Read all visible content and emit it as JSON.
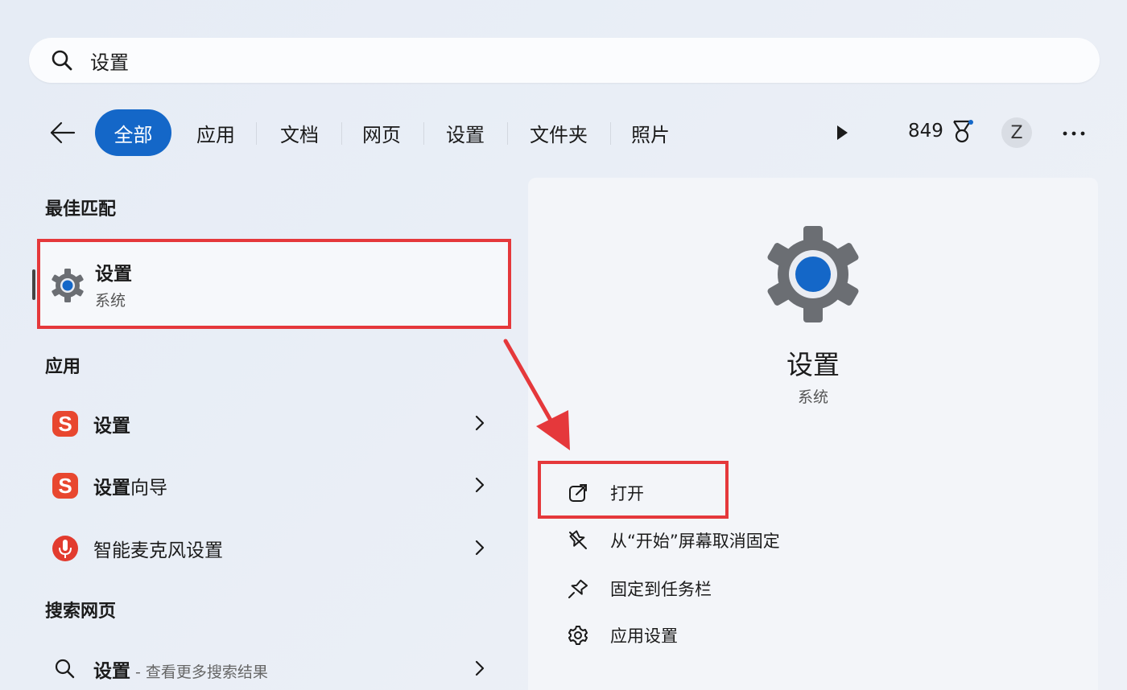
{
  "search": {
    "value": "设置"
  },
  "filters": {
    "tabs": [
      {
        "label": "全部",
        "active": true
      },
      {
        "label": "应用"
      },
      {
        "label": "文档"
      },
      {
        "label": "网页"
      },
      {
        "label": "设置"
      },
      {
        "label": "文件夹"
      },
      {
        "label": "照片"
      }
    ],
    "points": "849",
    "avatar_initial": "Z"
  },
  "best_match": {
    "title": "最佳匹配",
    "item": {
      "name": "设置",
      "subtitle": "系统",
      "icon": "gear-icon"
    }
  },
  "apps": {
    "title": "应用",
    "items": [
      {
        "bold": "设置",
        "rest": "",
        "icon": "sogou-icon"
      },
      {
        "bold": "设置",
        "rest": "向导",
        "icon": "sogou-icon"
      },
      {
        "bold": "",
        "rest": "智能麦克风设置",
        "icon": "mic-settings-icon"
      }
    ]
  },
  "web_search": {
    "title": "搜索网页",
    "item": {
      "bold": "设置",
      "hint": " - 查看更多搜索结果"
    }
  },
  "detail": {
    "title": "设置",
    "subtitle": "系统",
    "actions": [
      {
        "label": "打开",
        "icon": "open-external-icon"
      },
      {
        "label": "从“开始”屏幕取消固定",
        "icon": "unpin-icon"
      },
      {
        "label": "固定到任务栏",
        "icon": "pin-icon"
      },
      {
        "label": "应用设置",
        "icon": "gear-icon"
      }
    ]
  },
  "colors": {
    "accent": "#1467c8",
    "highlight": "#e5383b",
    "sogou": "#e8472f"
  }
}
